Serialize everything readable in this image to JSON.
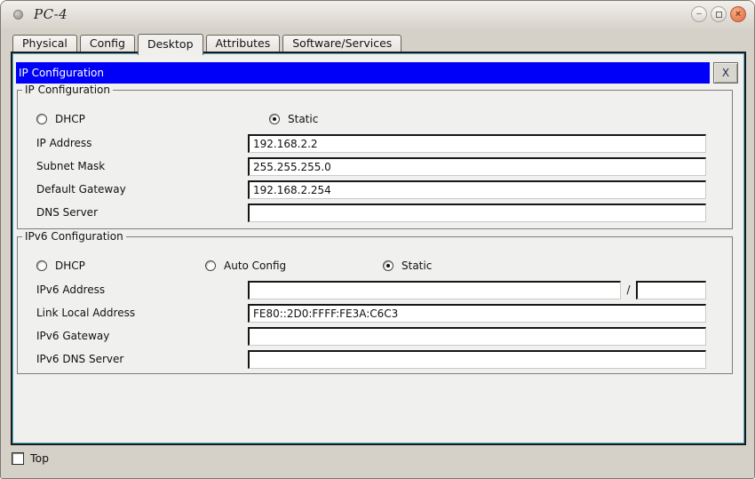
{
  "window": {
    "title": "PC-4",
    "controls": {
      "minimize": "−",
      "maximize": "",
      "close": "×"
    }
  },
  "tabs": [
    {
      "label": "Physical",
      "active": false
    },
    {
      "label": "Config",
      "active": false
    },
    {
      "label": "Desktop",
      "active": true
    },
    {
      "label": "Attributes",
      "active": false
    },
    {
      "label": "Software/Services",
      "active": false
    }
  ],
  "app": {
    "title": "IP Configuration",
    "close_label": "X"
  },
  "ip_config": {
    "legend": "IP Configuration",
    "radios": [
      {
        "label": "DHCP",
        "selected": false
      },
      {
        "label": "Static",
        "selected": true
      }
    ],
    "fields": [
      {
        "label": "IP Address",
        "value": "192.168.2.2"
      },
      {
        "label": "Subnet Mask",
        "value": "255.255.255.0"
      },
      {
        "label": "Default Gateway",
        "value": "192.168.2.254"
      },
      {
        "label": "DNS Server",
        "value": ""
      }
    ]
  },
  "ipv6_config": {
    "legend": "IPv6 Configuration",
    "radios": [
      {
        "label": "DHCP",
        "selected": false
      },
      {
        "label": "Auto Config",
        "selected": false
      },
      {
        "label": "Static",
        "selected": true
      }
    ],
    "fields": [
      {
        "label": "IPv6 Address",
        "value": "",
        "has_prefix": true,
        "prefix_separator": "/",
        "prefix_value": ""
      },
      {
        "label": "Link Local Address",
        "value": "FE80::2D0:FFFF:FE3A:C6C3"
      },
      {
        "label": "IPv6 Gateway",
        "value": ""
      },
      {
        "label": "IPv6 DNS Server",
        "value": ""
      }
    ]
  },
  "footer": {
    "checkbox_label": "Top",
    "checked": false
  },
  "colors": {
    "titlebar_blue": "#0000f8",
    "highlight_cyan": "#55b4cf",
    "window_bg": "#d5d1c8",
    "panel_bg": "#f0f0ee",
    "close_button_orange": "#dd6a3c"
  }
}
